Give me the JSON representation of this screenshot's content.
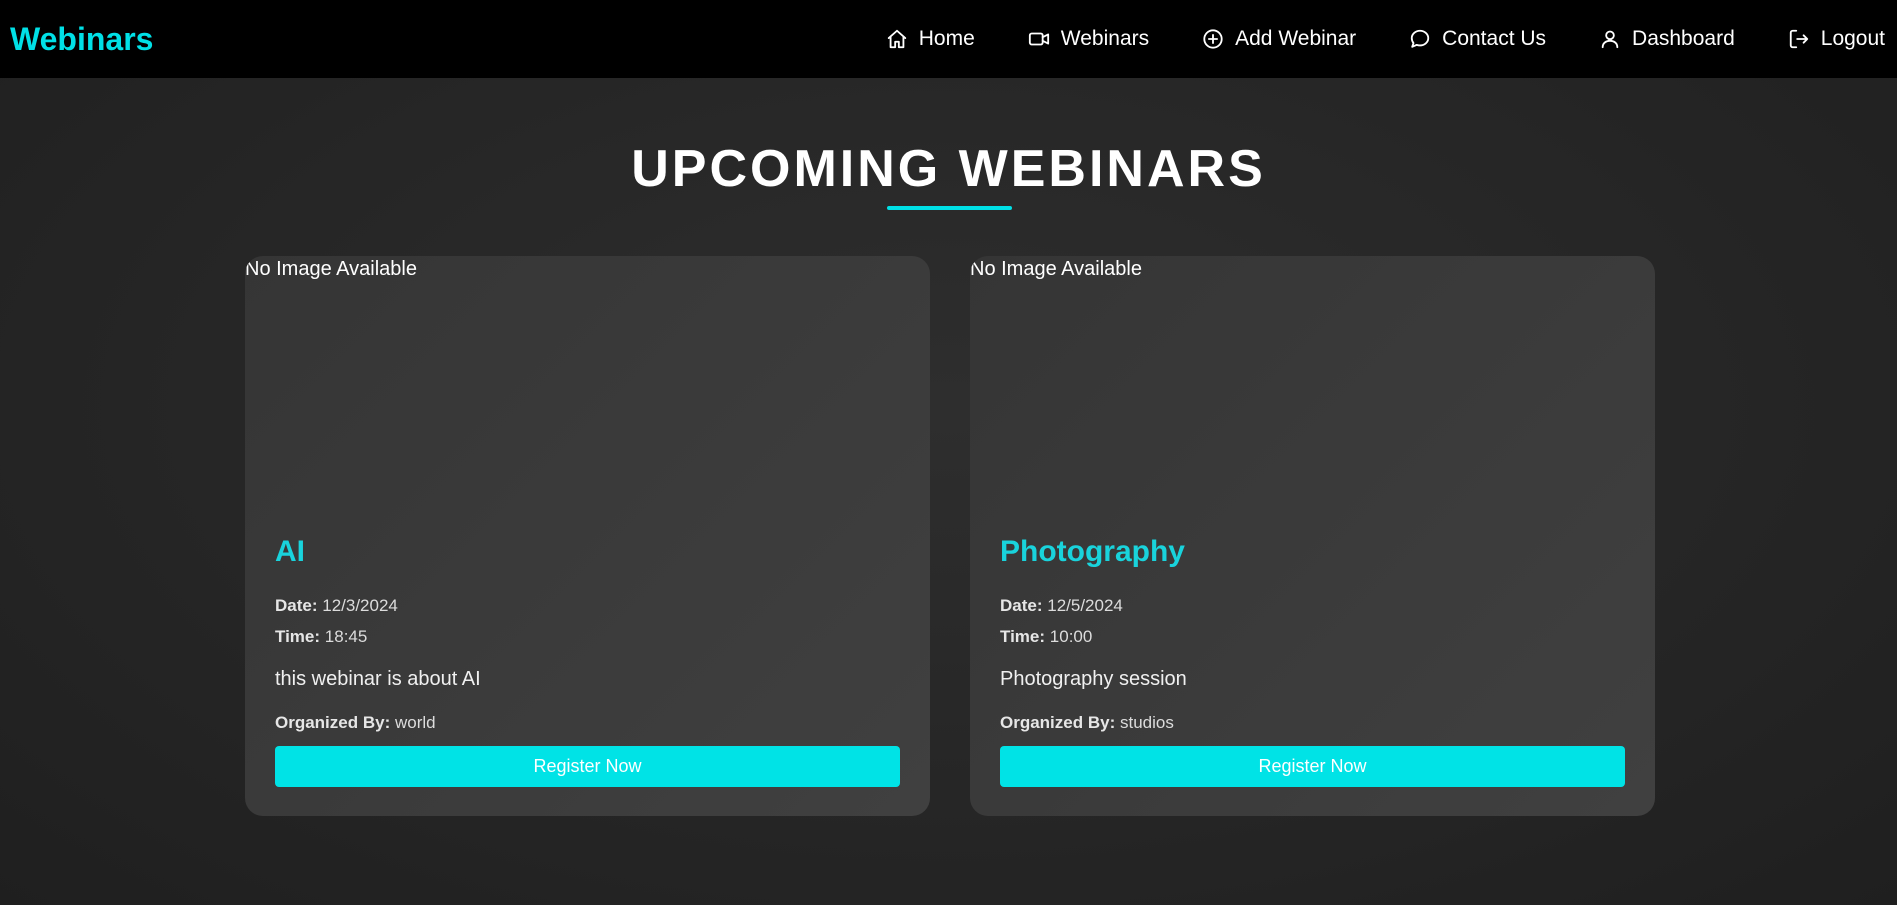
{
  "navbar": {
    "brand": "Webinars",
    "brand_color": "#00e0e6",
    "items": [
      {
        "label": "Home",
        "icon": "home-icon"
      },
      {
        "label": "Webinars",
        "icon": "video-icon"
      },
      {
        "label": "Add Webinar",
        "icon": "plus-circle-icon"
      },
      {
        "label": "Contact Us",
        "icon": "chat-bubble-icon"
      },
      {
        "label": "Dashboard",
        "icon": "user-icon"
      },
      {
        "label": "Logout",
        "icon": "logout-icon"
      }
    ]
  },
  "main": {
    "title": "UPCOMING WEBINARS",
    "accent_color": "#00e0e6"
  },
  "webinars": [
    {
      "image_text": "No Image Available",
      "title": "AI",
      "date_label": "Date:",
      "date": "12/3/2024",
      "time_label": "Time:",
      "time": "18:45",
      "description": "this webinar is about AI",
      "organizer_label": "Organized By:",
      "organizer": "world",
      "button_label": "Register Now"
    },
    {
      "image_text": "No Image Available",
      "title": "Photography",
      "date_label": "Date:",
      "date": "12/5/2024",
      "time_label": "Time:",
      "time": "10:00",
      "description": "Photography session",
      "organizer_label": "Organized By:",
      "organizer": "studios",
      "button_label": "Register Now"
    }
  ]
}
